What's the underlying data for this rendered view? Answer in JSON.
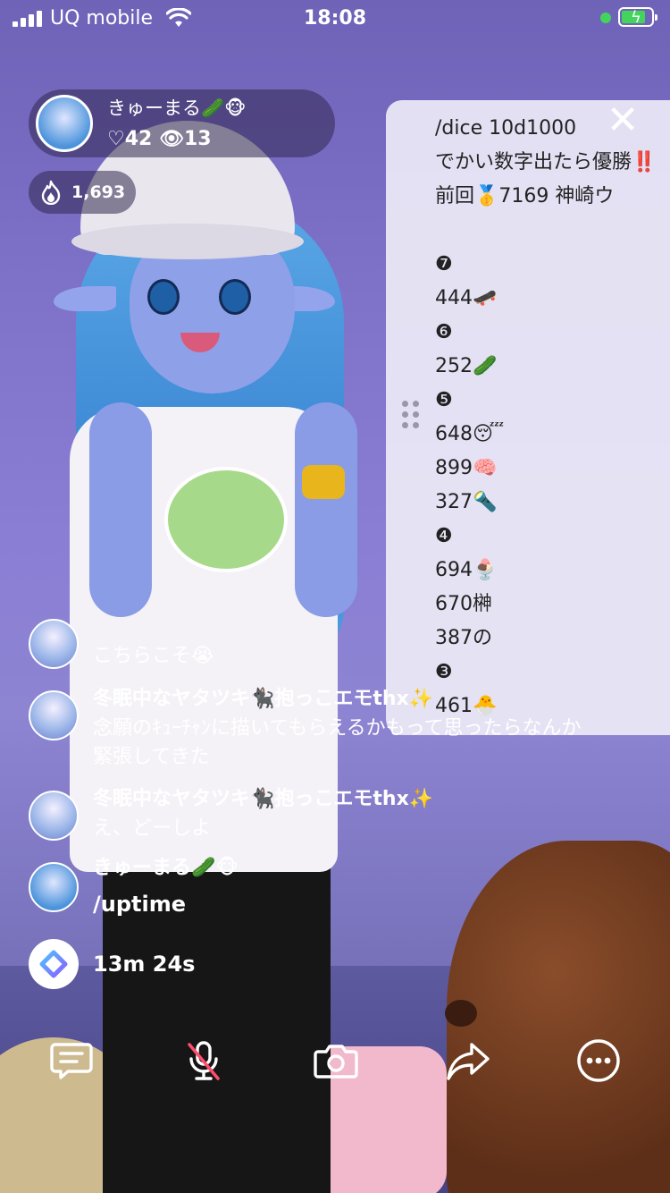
{
  "status_bar": {
    "carrier": "UQ mobile",
    "time": "18:08",
    "battery_level": 0.8
  },
  "host": {
    "name": "きゅーまる🥒🐵",
    "likes": "♡42",
    "viewers": "👁13",
    "points": "1,693"
  },
  "dice_panel": {
    "close_icon": "close-icon",
    "lines": [
      "/dice 10d1000",
      "でかい数字出たら優勝‼️",
      "前回🥇7169 神崎ウ",
      "",
      "❼",
      "444🛹",
      "❻",
      "252🥒",
      "❺",
      "648😴",
      "899🧠",
      "327🔦",
      "❹",
      "694🍨",
      "670榊",
      "387の",
      "❸",
      "461🐣"
    ]
  },
  "chat": {
    "partial_message": "こちらこそ😭",
    "messages": [
      {
        "name": "冬眠中なヤタツキ🐈‍⬛抱っこエモthx✨",
        "lines": [
          "念願のｷｭｰﾁｬﾝに描いてもらえるかもって思ったらなんか",
          "緊張してきた"
        ]
      },
      {
        "name": "冬眠中なヤタツキ🐈‍⬛抱っこエモthx✨",
        "lines": [
          "え、どーしよ"
        ]
      },
      {
        "name": "きゅーまる🥒🐵",
        "lines": [
          "/uptime"
        ]
      },
      {
        "name": "",
        "lines": [
          "13m 24s"
        ]
      }
    ]
  },
  "toolbar": {
    "icons": [
      "comment-icon",
      "mic-off-icon",
      "camera-icon",
      "share-icon",
      "more-icon"
    ]
  },
  "colors": {
    "background": "#8a7ed4",
    "panel": "#ecEAF6",
    "battery_green": "#42d45b",
    "mic_off_red": "#ff4d6d"
  }
}
